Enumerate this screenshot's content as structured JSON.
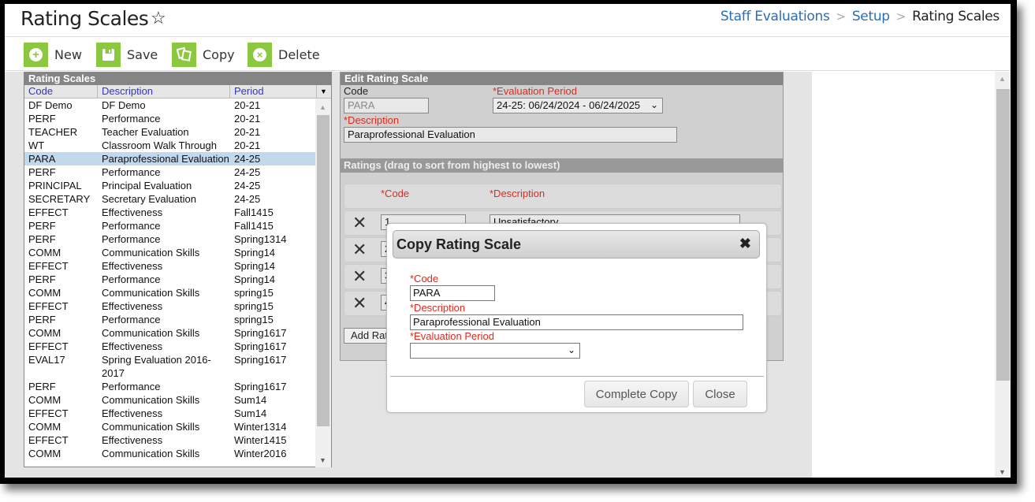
{
  "header": {
    "title": "Rating Scales",
    "favorite_icon": "star-outline-icon",
    "breadcrumb": [
      "Staff Evaluations",
      "Setup",
      "Rating Scales"
    ]
  },
  "toolbar": {
    "new_label": "New",
    "save_label": "Save",
    "copy_label": "Copy",
    "delete_label": "Delete"
  },
  "list": {
    "title": "Rating Scales",
    "columns": [
      "Code",
      "Description",
      "Period"
    ],
    "rows": [
      {
        "code": "DF Demo",
        "description": "DF Demo",
        "period": "20-21"
      },
      {
        "code": "PERF",
        "description": "Performance",
        "period": "20-21"
      },
      {
        "code": "TEACHER",
        "description": "Teacher Evaluation",
        "period": "20-21"
      },
      {
        "code": "WT",
        "description": "Classroom Walk Through",
        "period": "20-21"
      },
      {
        "code": "PARA",
        "description": "Paraprofessional Evaluation",
        "period": "24-25",
        "selected": true
      },
      {
        "code": "PERF",
        "description": "Performance",
        "period": "24-25"
      },
      {
        "code": "PRINCIPAL",
        "description": "Principal Evaluation",
        "period": "24-25"
      },
      {
        "code": "SECRETARY",
        "description": "Secretary Evaluation",
        "period": "24-25"
      },
      {
        "code": "EFFECT",
        "description": "Effectiveness",
        "period": "Fall1415"
      },
      {
        "code": "PERF",
        "description": "Performance",
        "period": "Fall1415"
      },
      {
        "code": "PERF",
        "description": "Performance",
        "period": "Spring1314"
      },
      {
        "code": "COMM",
        "description": "Communication Skills",
        "period": "Spring14"
      },
      {
        "code": "EFFECT",
        "description": "Effectiveness",
        "period": "Spring14"
      },
      {
        "code": "PERF",
        "description": "Performance",
        "period": "Spring14"
      },
      {
        "code": "COMM",
        "description": "Communication Skills",
        "period": "spring15"
      },
      {
        "code": "EFFECT",
        "description": "Effectiveness",
        "period": "spring15"
      },
      {
        "code": "PERF",
        "description": "Performance",
        "period": "spring15"
      },
      {
        "code": "COMM",
        "description": "Communication Skills",
        "period": "Spring1617"
      },
      {
        "code": "EFFECT",
        "description": "Effectiveness",
        "period": "Spring1617"
      },
      {
        "code": "EVAL17",
        "description": "Spring Evaluation 2016-2017",
        "period": "Spring1617"
      },
      {
        "code": "PERF",
        "description": "Performance",
        "period": "Spring1617"
      },
      {
        "code": "COMM",
        "description": "Communication Skills",
        "period": "Sum14"
      },
      {
        "code": "EFFECT",
        "description": "Effectiveness",
        "period": "Sum14"
      },
      {
        "code": "COMM",
        "description": "Communication Skills",
        "period": "Winter1314"
      },
      {
        "code": "EFFECT",
        "description": "Effectiveness",
        "period": "Winter1415"
      },
      {
        "code": "COMM",
        "description": "Communication Skills",
        "period": "Winter2016"
      }
    ]
  },
  "edit": {
    "title": "Edit Rating Scale",
    "code_label": "Code",
    "code_value": "PARA",
    "period_label": "*Evaluation Period",
    "period_value": "24-25: 06/24/2024 - 06/24/2025",
    "description_label": "*Description",
    "description_value": "Paraprofessional Evaluation",
    "ratings_title": "Ratings (drag to sort from highest to lowest)",
    "ratings_code_header": "*Code",
    "ratings_desc_header": "*Description",
    "ratings": [
      {
        "code": "1",
        "description": "Unsatisfactory"
      },
      {
        "code": "2",
        "description": ""
      },
      {
        "code": "3",
        "description": ""
      },
      {
        "code": "4",
        "description": ""
      }
    ],
    "add_rating_label": "Add Rating"
  },
  "modal": {
    "title": "Copy Rating Scale",
    "code_label": "*Code",
    "code_value": "PARA",
    "description_label": "*Description",
    "description_value": "Paraprofessional Evaluation",
    "period_label": "*Evaluation Period",
    "period_value": "",
    "complete_label": "Complete Copy",
    "close_label": "Close"
  },
  "colors": {
    "accent_green": "#8dc63f",
    "link_blue": "#2a6ebb",
    "required_red": "#e0281e",
    "selected_row": "#c2d8ec",
    "panel_header": "#858585"
  }
}
